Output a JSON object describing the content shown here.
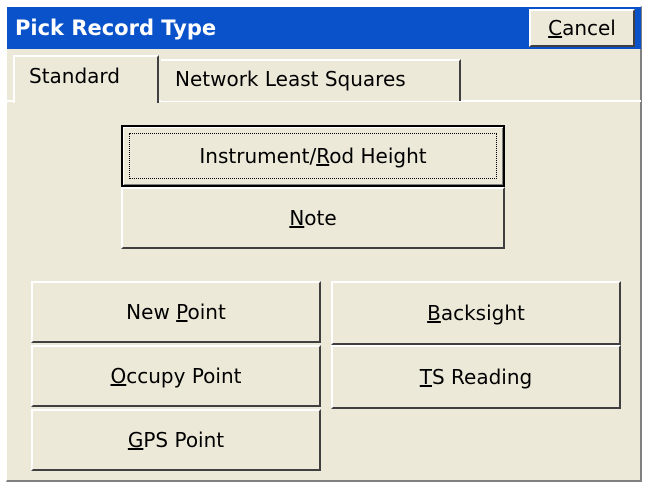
{
  "dialog": {
    "title": "Pick Record Type",
    "cancel_label": "Cancel",
    "cancel_mnemonic": "C"
  },
  "tabs": [
    {
      "label": "Standard",
      "selected": true
    },
    {
      "label": "Network Least Squares",
      "selected": false
    }
  ],
  "buttons": {
    "instrument_rod_height": {
      "label": "Instrument/Rod Height",
      "mnemonic": "R",
      "focused": true
    },
    "note": {
      "label": "Note",
      "mnemonic": "N"
    },
    "new_point": {
      "label": "New Point",
      "mnemonic": "P"
    },
    "occupy_point": {
      "label": "Occupy Point",
      "mnemonic": "O"
    },
    "gps_point": {
      "label": "GPS Point",
      "mnemonic": "G"
    },
    "backsight": {
      "label": "Backsight",
      "mnemonic": "B"
    },
    "ts_reading": {
      "label": "TS Reading",
      "mnemonic": "T"
    }
  },
  "colors": {
    "titlebar": "#0a52c9",
    "face": "#ece9d8"
  }
}
